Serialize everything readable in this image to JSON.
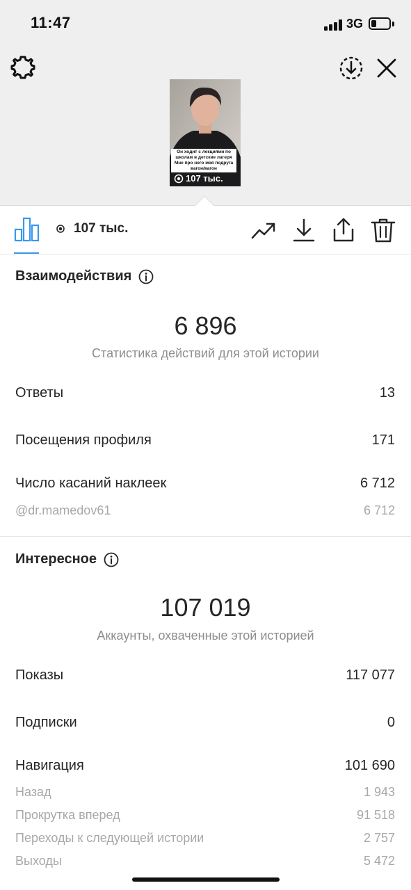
{
  "status_bar": {
    "time": "11:47",
    "network": "3G",
    "battery_level": 0.3
  },
  "header": {
    "settings_icon": "gear-icon",
    "download_icon": "download-circle-icon",
    "close_icon": "close-icon"
  },
  "story_preview": {
    "caption": "Он ходит с лекциями по школам в детские лагеря Мне про него моя подруга вагон/вагон",
    "views": "107 тыс."
  },
  "toolbar": {
    "views_count": "107 тыс.",
    "accent_color": "#3897f0"
  },
  "interactions": {
    "title": "Взаимодействия",
    "total": "6 896",
    "caption": "Статистика действий для этой истории",
    "rows": [
      {
        "label": "Ответы",
        "value": "13"
      },
      {
        "label": "Посещения профиля",
        "value": "171"
      },
      {
        "label": "Число касаний наклеек",
        "value": "6 712"
      }
    ],
    "sub_rows": [
      {
        "label": "@dr.mamedov61",
        "value": "6 712"
      }
    ]
  },
  "discovery": {
    "title": "Интересное",
    "total": "107 019",
    "caption": "Аккаунты, охваченные этой историей",
    "rows": [
      {
        "label": "Показы",
        "value": "117 077"
      },
      {
        "label": "Подписки",
        "value": "0"
      },
      {
        "label": "Навигация",
        "value": "101 690"
      }
    ],
    "sub_rows": [
      {
        "label": "Назад",
        "value": "1 943"
      },
      {
        "label": "Прокрутка вперед",
        "value": "91 518"
      },
      {
        "label": "Переходы к следующей истории",
        "value": "2 757"
      },
      {
        "label": "Выходы",
        "value": "5 472"
      }
    ]
  }
}
